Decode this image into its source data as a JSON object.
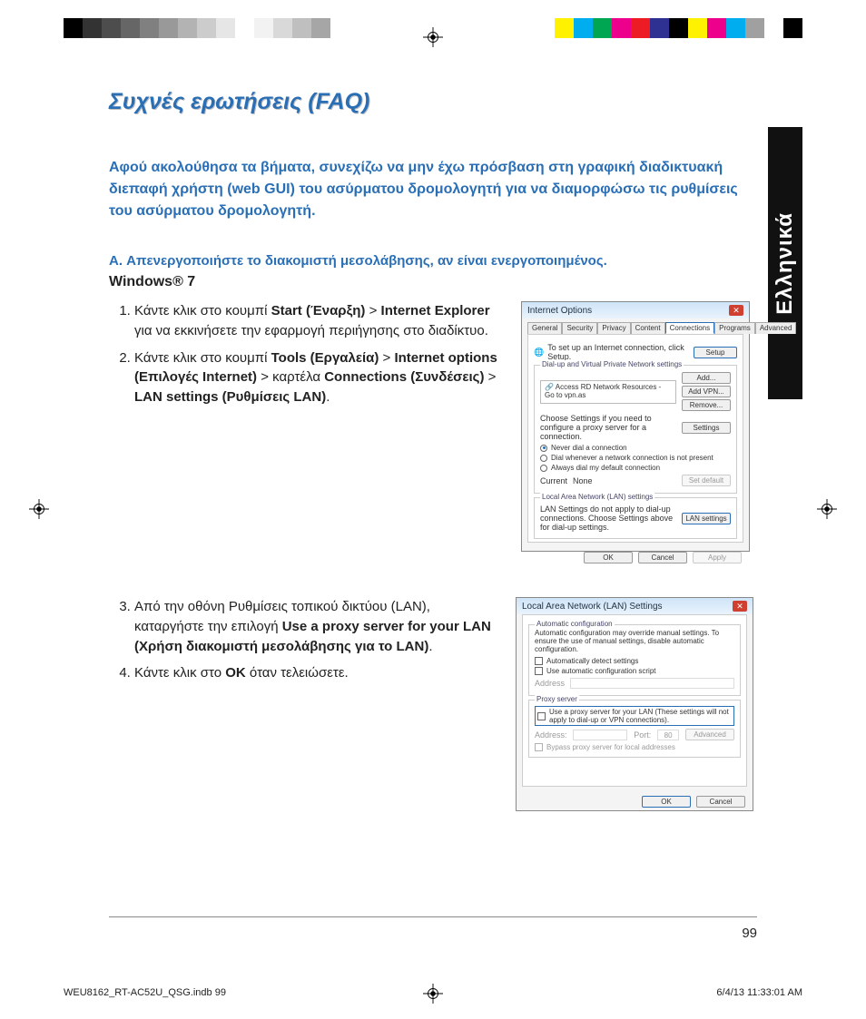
{
  "colorbars": {
    "left": [
      "#000000",
      "#333333",
      "#4d4d4d",
      "#666666",
      "#808080",
      "#999999",
      "#b3b3b3",
      "#cccccc",
      "#e6e6e6",
      "#ffffff",
      "#f2f2f2",
      "#d9d9d9",
      "#bfbfbf",
      "#a6a6a6"
    ],
    "right": [
      "#ffffff",
      "#fff200",
      "#00aeef",
      "#00a651",
      "#ec008c",
      "#ed1c24",
      "#2e3192",
      "#000000",
      "#fff200",
      "#ec008c",
      "#00aeef",
      "#a0a0a0",
      "#ffffff",
      "#000000"
    ]
  },
  "sidetab": "Ελληνικά",
  "title": "Συχνές ερωτήσεις (FAQ)",
  "intro": "Αφού ακολούθησα τα βήματα, συνεχίζω να μην έχω πρόσβαση στη γραφική διαδικτυακή διεπαφή χρήστη (web GUI) του ασύρματου δρομολογητή για να διαμορφώσω τις ρυθμίσεις του ασύρματου δρομολογητή.",
  "sectionA": "A.   Απενεργοποιήστε το διακομιστή μεσολάβησης, αν είναι ενεργοποιημένος.",
  "os_label": "Windows® 7",
  "step1": {
    "pre": "Κάντε κλικ στο κουμπί ",
    "b1": "Start (Έναρξη)",
    "mid1": " > ",
    "b2": "Internet Explorer",
    "post": " για να εκκινήσετε την εφαρμογή περιήγησης στο διαδίκτυο."
  },
  "step2": {
    "pre": "Κάντε κλικ στο κουμπί ",
    "b1": "Tools (Εργαλεία)",
    "mid1": " > ",
    "b2": "Internet options (Επιλογές Internet)",
    "mid2": " > καρτέλα ",
    "b3": "Connections (Συνδέσεις)",
    "mid3": " > ",
    "b4": "LAN settings (Ρυθμίσεις LAN)",
    "post": "."
  },
  "step3": {
    "pre": "Από την οθόνη Ρυθμίσεις τοπικού δικτύου (LAN), καταργήστε την επιλογή ",
    "b1": "Use a proxy server for your LAN (Χρήση διακομιστή μεσολάβησης για το LAN)",
    "post": "."
  },
  "step4": {
    "pre": "Κάντε κλικ στο ",
    "b1": "OK",
    "post": " όταν τελειώσετε."
  },
  "dlg_inet": {
    "title": "Internet Options",
    "tabs": [
      "General",
      "Security",
      "Privacy",
      "Content",
      "Connections",
      "Programs",
      "Advanced"
    ],
    "setup_text": "To set up an Internet connection, click Setup.",
    "btn_setup": "Setup",
    "group_dial": "Dial-up and Virtual Private Network settings",
    "list_item": "Access RD Network Resources - Go to vpn.as",
    "btn_add": "Add...",
    "btn_addvpn": "Add VPN...",
    "btn_remove": "Remove...",
    "proxy_hint": "Choose Settings if you need to configure a proxy server for a connection.",
    "btn_settings": "Settings",
    "r_never": "Never dial a connection",
    "r_when": "Dial whenever a network connection is not present",
    "r_always": "Always dial my default connection",
    "current": "Current",
    "none": "None",
    "btn_setdefault": "Set default",
    "group_lan": "Local Area Network (LAN) settings",
    "lan_hint": "LAN Settings do not apply to dial-up connections. Choose Settings above for dial-up settings.",
    "btn_lan": "LAN settings",
    "ok": "OK",
    "cancel": "Cancel",
    "apply": "Apply"
  },
  "dlg_lan": {
    "title": "Local Area Network (LAN) Settings",
    "group_auto": "Automatic configuration",
    "auto_hint": "Automatic configuration may override manual settings. To ensure the use of manual settings, disable automatic configuration.",
    "chk_detect": "Automatically detect settings",
    "chk_script": "Use automatic configuration script",
    "addr": "Address",
    "group_proxy": "Proxy server",
    "chk_proxy": "Use a proxy server for your LAN (These settings will not apply to dial-up or VPN connections).",
    "addr2": "Address:",
    "port": "Port:",
    "port_val": "80",
    "btn_adv": "Advanced",
    "chk_bypass": "Bypass proxy server for local addresses",
    "ok": "OK",
    "cancel": "Cancel"
  },
  "page_number": "99",
  "print_footer": {
    "left": "WEU8162_RT-AC52U_QSG.indb   99",
    "right": "6/4/13   11:33:01 AM"
  }
}
